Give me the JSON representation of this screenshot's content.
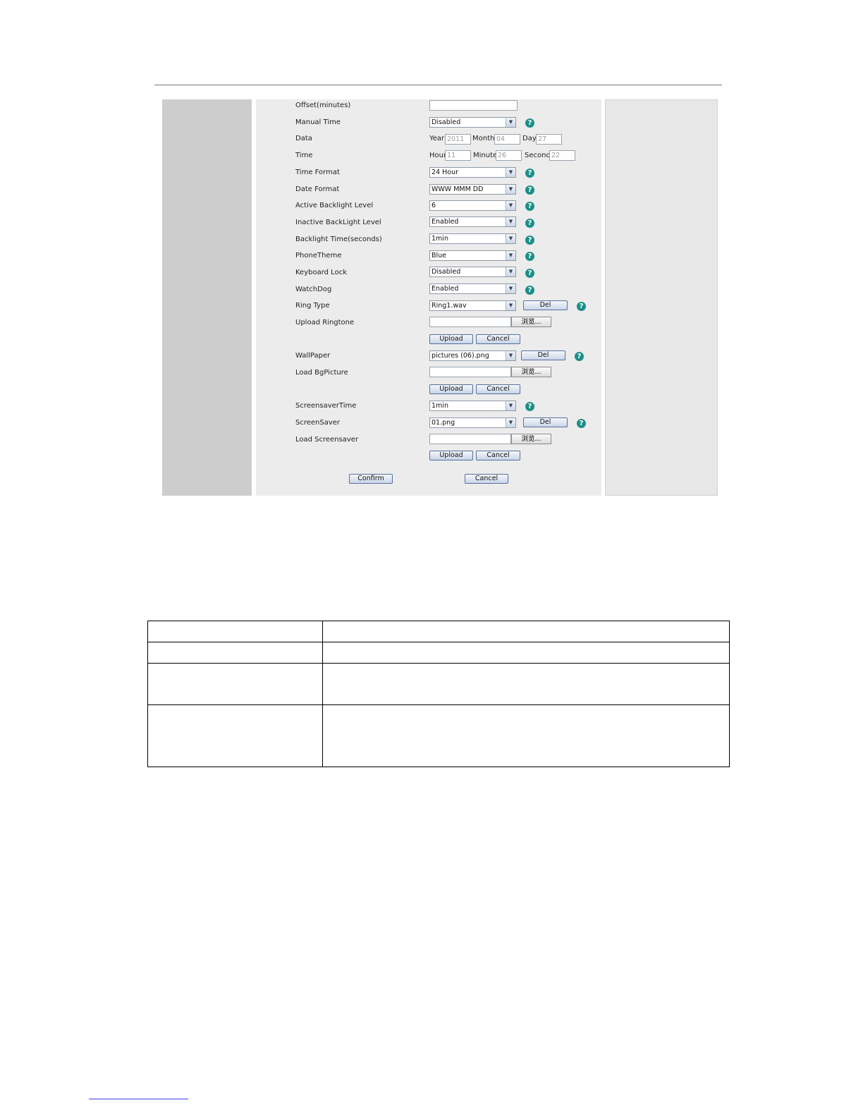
{
  "form": {
    "offset_label": "Offset(minutes)",
    "manual_time_label": "Manual Time",
    "manual_time_value": "Disabled",
    "data_label": "Data",
    "year_label": "Year",
    "year_value": "2011",
    "month_label": "Month",
    "month_value": "04",
    "day_label": "Day",
    "day_value": "27",
    "time_label": "Time",
    "hour_label": "Hour",
    "hour_value": "11",
    "minute_label": "Minute",
    "minute_value": "26",
    "second_label": "Second",
    "second_value": "22",
    "time_format_label": "Time Format",
    "time_format_value": "24 Hour",
    "date_format_label": "Date Format",
    "date_format_value": "WWW MMM DD",
    "active_backlight_label": "Active Backlight Level",
    "active_backlight_value": "6",
    "inactive_backlight_label": "Inactive BackLight Level",
    "inactive_backlight_value": "Enabled",
    "backlight_time_label": "Backlight Time(seconds)",
    "backlight_time_value": "1min",
    "phone_theme_label": "PhoneTheme",
    "phone_theme_value": "Blue",
    "keyboard_lock_label": "Keyboard Lock",
    "keyboard_lock_value": "Disabled",
    "watchdog_label": "WatchDog",
    "watchdog_value": "Enabled",
    "ring_type_label": "Ring Type",
    "ring_type_value": "Ring1.wav",
    "upload_ringtone_label": "Upload Ringtone",
    "wallpaper_label": "WallPaper",
    "wallpaper_value": "pictures (06).png",
    "load_bgpicture_label": "Load BgPicture",
    "screensaver_time_label": "ScreensaverTime",
    "screensaver_time_value": "1min",
    "screensaver_label": "ScreenSaver",
    "screensaver_value": "01.png",
    "load_screensaver_label": "Load Screensaver",
    "del_label": "Del",
    "browse_label": "浏览...",
    "upload_label": "Upload",
    "cancel_label": "Cancel",
    "confirm_label": "Confirm",
    "help_glyph": "?"
  },
  "colors": {
    "help_icon": "#1b8f88",
    "left_panel": "#cdcdcd",
    "center_panel": "#ececec",
    "right_panel": "#e7e7e7"
  }
}
